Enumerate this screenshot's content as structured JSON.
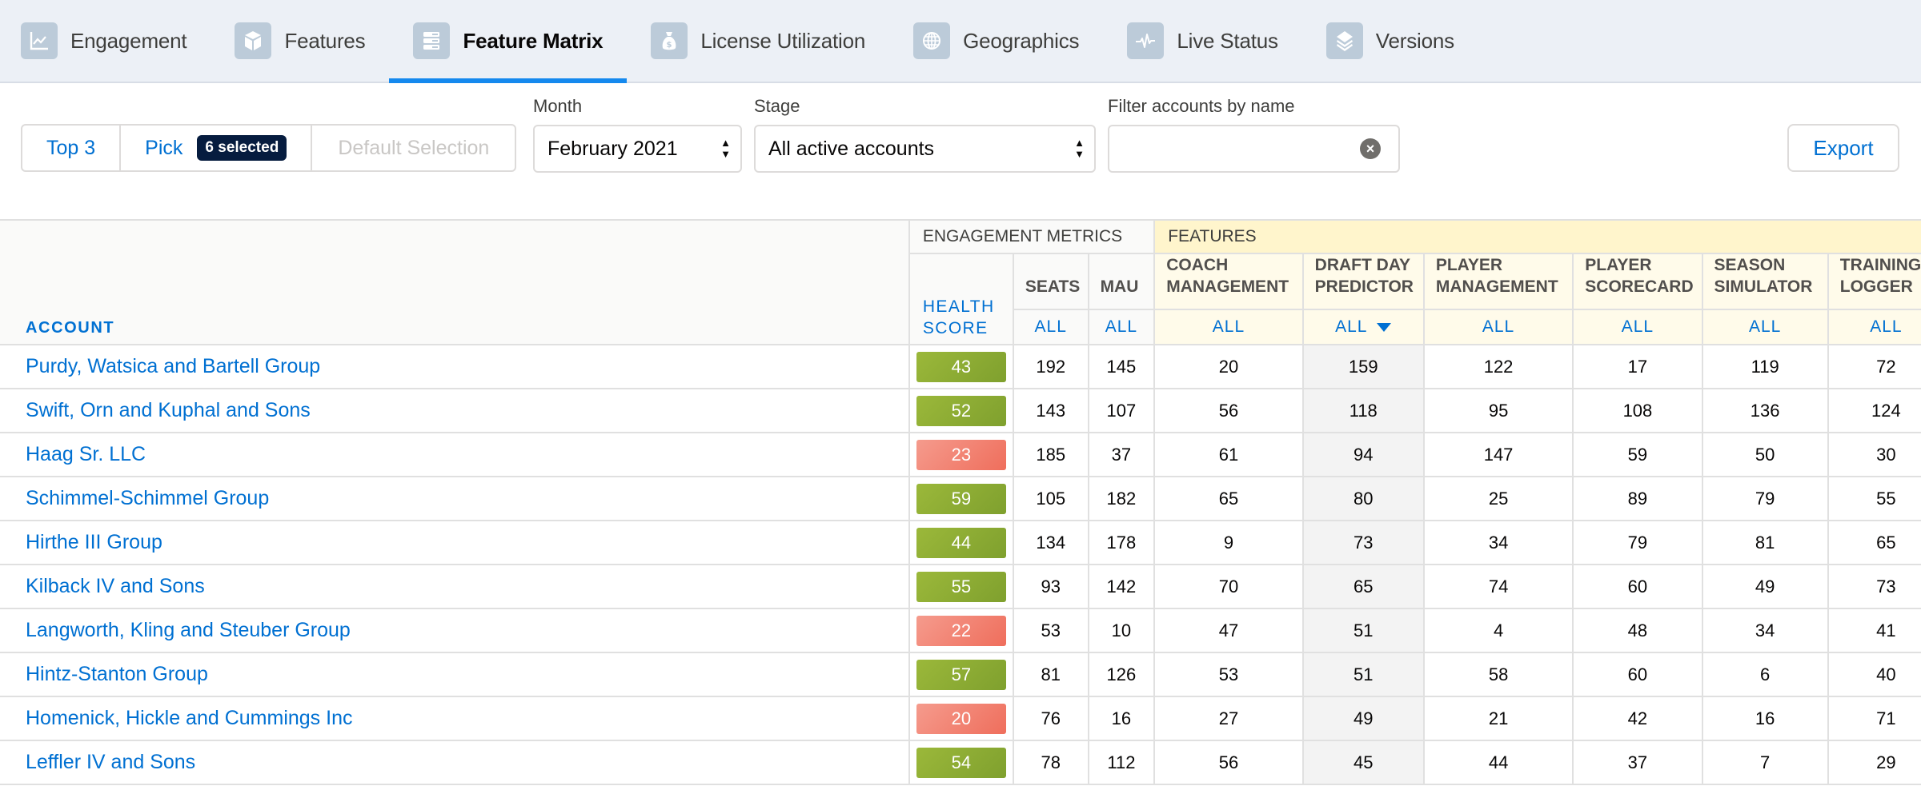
{
  "tabs": [
    {
      "label": "Engagement",
      "icon": "line-chart-icon",
      "active": false
    },
    {
      "label": "Features",
      "icon": "cube-icon",
      "active": false
    },
    {
      "label": "Feature Matrix",
      "icon": "matrix-icon",
      "active": true
    },
    {
      "label": "License Utilization",
      "icon": "money-bag-icon",
      "active": false
    },
    {
      "label": "Geographics",
      "icon": "globe-icon",
      "active": false
    },
    {
      "label": "Live Status",
      "icon": "pulse-icon",
      "active": false
    },
    {
      "label": "Versions",
      "icon": "layers-icon",
      "active": false
    }
  ],
  "filters": {
    "segments": {
      "top3": "Top 3",
      "pick": "Pick",
      "pick_badge": "6 selected",
      "default": "Default Selection"
    },
    "month": {
      "label": "Month",
      "value": "February 2021"
    },
    "stage": {
      "label": "Stage",
      "value": "All active accounts"
    },
    "search": {
      "label": "Filter accounts by name",
      "value": "",
      "placeholder": ""
    },
    "export": "Export"
  },
  "table": {
    "group_engagement": "ENGAGEMENT METRICS",
    "group_features": "FEATURES",
    "account_header": "ACCOUNT",
    "health_header_1": "HEALTH",
    "health_header_2": "SCORE",
    "all_label": "ALL",
    "columns": [
      {
        "line1": "SEATS",
        "line2": "",
        "group": "engagement"
      },
      {
        "line1": "MAU",
        "line2": "",
        "group": "engagement"
      },
      {
        "line1": "COACH",
        "line2": "MANAGEMENT",
        "group": "features"
      },
      {
        "line1": "DRAFT DAY",
        "line2": "PREDICTOR",
        "group": "features",
        "sorted": "desc"
      },
      {
        "line1": "PLAYER",
        "line2": "MANAGEMENT",
        "group": "features"
      },
      {
        "line1": "PLAYER",
        "line2": "SCORECARD",
        "group": "features"
      },
      {
        "line1": "SEASON",
        "line2": "SIMULATOR",
        "group": "features"
      },
      {
        "line1": "TRAINING",
        "line2": "LOGGER",
        "group": "features"
      }
    ],
    "colors": {
      "good": "#8aab33",
      "bad": "#f17f6f",
      "link": "#0070d2"
    },
    "rows": [
      {
        "account": "Purdy, Watsica and Bartell Group",
        "health": "43",
        "status": "good",
        "values": [
          "192",
          "145",
          "20",
          "159",
          "122",
          "17",
          "119",
          "72"
        ]
      },
      {
        "account": "Swift, Orn and Kuphal and Sons",
        "health": "52",
        "status": "good",
        "values": [
          "143",
          "107",
          "56",
          "118",
          "95",
          "108",
          "136",
          "124"
        ]
      },
      {
        "account": "Haag Sr. LLC",
        "health": "23",
        "status": "bad",
        "values": [
          "185",
          "37",
          "61",
          "94",
          "147",
          "59",
          "50",
          "30"
        ]
      },
      {
        "account": "Schimmel-Schimmel Group",
        "health": "59",
        "status": "good",
        "values": [
          "105",
          "182",
          "65",
          "80",
          "25",
          "89",
          "79",
          "55"
        ]
      },
      {
        "account": "Hirthe III Group",
        "health": "44",
        "status": "good",
        "values": [
          "134",
          "178",
          "9",
          "73",
          "34",
          "79",
          "81",
          "65"
        ]
      },
      {
        "account": "Kilback IV and Sons",
        "health": "55",
        "status": "good",
        "values": [
          "93",
          "142",
          "70",
          "65",
          "74",
          "60",
          "49",
          "73"
        ]
      },
      {
        "account": "Langworth, Kling and Steuber Group",
        "health": "22",
        "status": "bad",
        "values": [
          "53",
          "10",
          "47",
          "51",
          "4",
          "48",
          "34",
          "41"
        ]
      },
      {
        "account": "Hintz-Stanton Group",
        "health": "57",
        "status": "good",
        "values": [
          "81",
          "126",
          "53",
          "51",
          "58",
          "60",
          "6",
          "40"
        ]
      },
      {
        "account": "Homenick, Hickle and Cummings Inc",
        "health": "20",
        "status": "bad",
        "values": [
          "76",
          "16",
          "27",
          "49",
          "21",
          "42",
          "16",
          "71"
        ]
      },
      {
        "account": "Leffler IV and Sons",
        "health": "54",
        "status": "good",
        "values": [
          "78",
          "112",
          "56",
          "45",
          "44",
          "37",
          "7",
          "29"
        ]
      }
    ]
  }
}
